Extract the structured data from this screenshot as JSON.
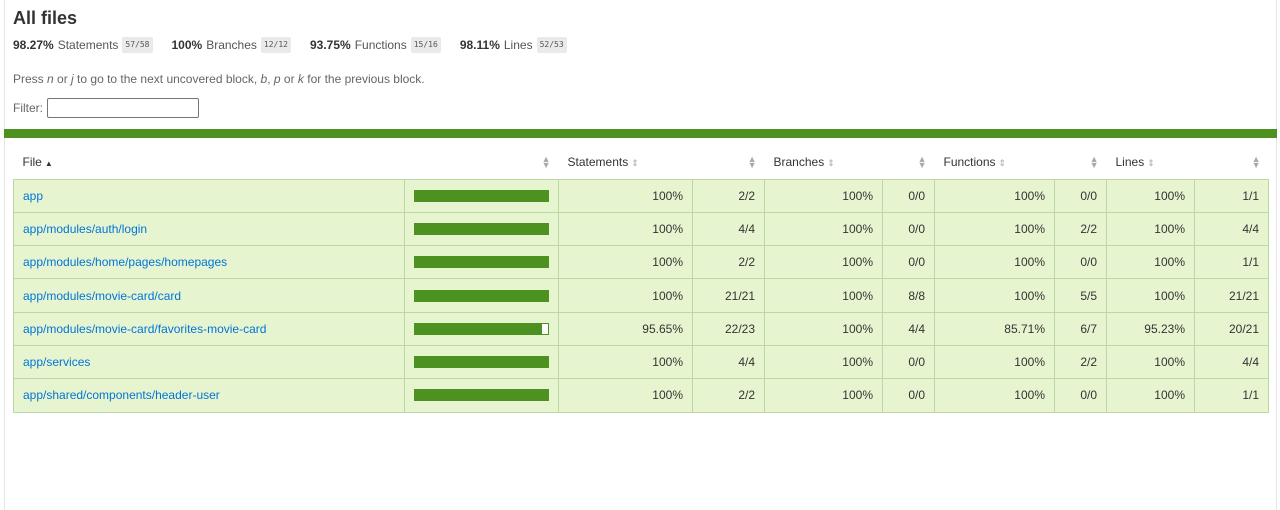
{
  "title": "All files",
  "summary": [
    {
      "pct": "98.27%",
      "label": "Statements",
      "frac": "57/58"
    },
    {
      "pct": "100%",
      "label": "Branches",
      "frac": "12/12"
    },
    {
      "pct": "93.75%",
      "label": "Functions",
      "frac": "15/16"
    },
    {
      "pct": "98.11%",
      "label": "Lines",
      "frac": "52/53"
    }
  ],
  "hint": {
    "p1": "Press ",
    "k1": "n",
    "p2": " or ",
    "k2": "j",
    "p3": " to go to the next uncovered block, ",
    "k3": "b",
    "p4": ", ",
    "k4": "p",
    "p5": " or ",
    "k5": "k",
    "p6": " for the previous block."
  },
  "filter": {
    "label": "Filter:",
    "value": ""
  },
  "colors": {
    "status_bar": "#4d9221",
    "row_bg": "#e6f5d0",
    "link": "#0074d9"
  },
  "table": {
    "headers": {
      "file": "File",
      "statements": "Statements",
      "branches": "Branches",
      "functions": "Functions",
      "lines": "Lines"
    },
    "rows": [
      {
        "file": "app",
        "coverage": 1.0,
        "stmt_pct": "100%",
        "stmt": "2/2",
        "br_pct": "100%",
        "br": "0/0",
        "fn_pct": "100%",
        "fn": "0/0",
        "ln_pct": "100%",
        "ln": "1/1"
      },
      {
        "file": "app/modules/auth/login",
        "coverage": 1.0,
        "stmt_pct": "100%",
        "stmt": "4/4",
        "br_pct": "100%",
        "br": "0/0",
        "fn_pct": "100%",
        "fn": "2/2",
        "ln_pct": "100%",
        "ln": "4/4"
      },
      {
        "file": "app/modules/home/pages/homepages",
        "coverage": 1.0,
        "stmt_pct": "100%",
        "stmt": "2/2",
        "br_pct": "100%",
        "br": "0/0",
        "fn_pct": "100%",
        "fn": "0/0",
        "ln_pct": "100%",
        "ln": "1/1"
      },
      {
        "file": "app/modules/movie-card/card",
        "coverage": 1.0,
        "stmt_pct": "100%",
        "stmt": "21/21",
        "br_pct": "100%",
        "br": "8/8",
        "fn_pct": "100%",
        "fn": "5/5",
        "ln_pct": "100%",
        "ln": "21/21"
      },
      {
        "file": "app/modules/movie-card/favorites-movie-card",
        "coverage": 0.9565,
        "stmt_pct": "95.65%",
        "stmt": "22/23",
        "br_pct": "100%",
        "br": "4/4",
        "fn_pct": "85.71%",
        "fn": "6/7",
        "ln_pct": "95.23%",
        "ln": "20/21"
      },
      {
        "file": "app/services",
        "coverage": 1.0,
        "stmt_pct": "100%",
        "stmt": "4/4",
        "br_pct": "100%",
        "br": "0/0",
        "fn_pct": "100%",
        "fn": "2/2",
        "ln_pct": "100%",
        "ln": "4/4"
      },
      {
        "file": "app/shared/components/header-user",
        "coverage": 1.0,
        "stmt_pct": "100%",
        "stmt": "2/2",
        "br_pct": "100%",
        "br": "0/0",
        "fn_pct": "100%",
        "fn": "0/0",
        "ln_pct": "100%",
        "ln": "1/1"
      }
    ]
  }
}
